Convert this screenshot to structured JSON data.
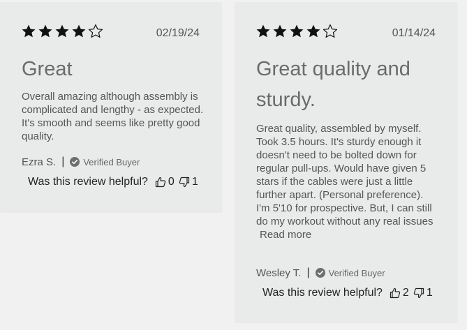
{
  "reviews": [
    {
      "rating": 4,
      "max_rating": 5,
      "date": "02/19/24",
      "title": "Great",
      "body": "Overall amazing although assembly is complicated and lengthy - as expected. It's smooth and seems like pretty good quality.",
      "read_more": "",
      "author": "Ezra S.",
      "separator": "|",
      "verified_label": "Verified Buyer",
      "helpful_question": "Was this review helpful?",
      "upvotes": "0",
      "downvotes": "1"
    },
    {
      "rating": 4,
      "max_rating": 5,
      "date": "01/14/24",
      "title": "Great quality and sturdy.",
      "body": "Great quality, assembled by myself. Took 3.5 hours. It's sturdy enough it doesn't need to be bolted down for regular pull-ups. Would have given 5 stars if the cables were just a little further apart. (Personal preference). I'm 5'10 for prospective. But, I can still do my workout without any real issues",
      "read_more": "Read more",
      "author": "Wesley T.",
      "separator": "|",
      "verified_label": "Verified Buyer",
      "helpful_question": "Was this review helpful?",
      "upvotes": "2",
      "downvotes": "1"
    }
  ],
  "icons": {
    "star_filled": "star-filled-icon",
    "star_empty": "star-outline-icon",
    "verified": "check-circle-icon",
    "thumbs_up": "thumbs-up-icon",
    "thumbs_down": "thumbs-down-icon"
  },
  "colors": {
    "card_bg": "#e9eaea",
    "page_bg": "#f1f1f1",
    "star": "#111111",
    "verified_badge": "#6e6e6e"
  }
}
